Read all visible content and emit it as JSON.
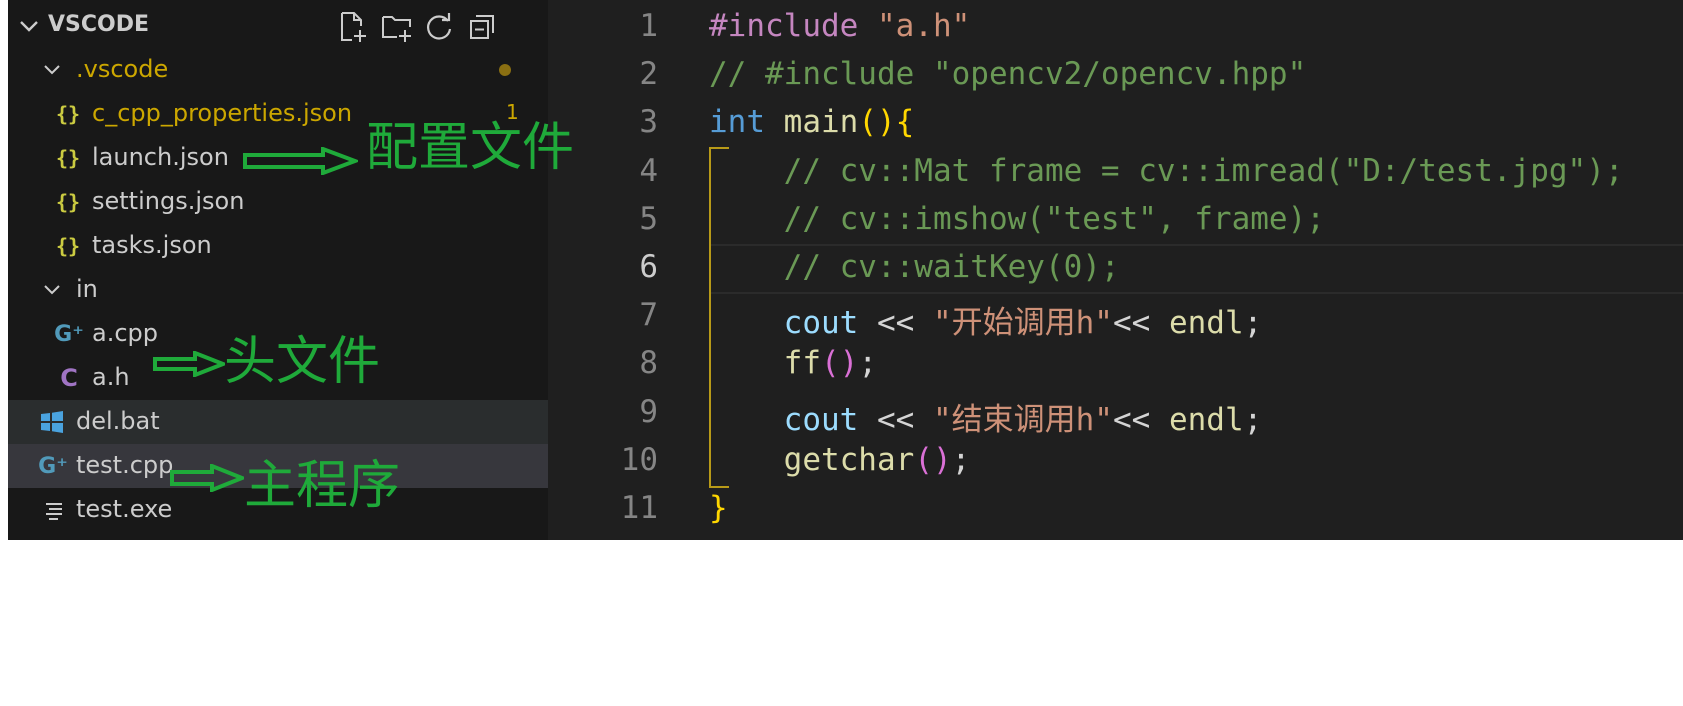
{
  "explorer": {
    "title": "VSCODE",
    "actions": [
      {
        "name": "new-file",
        "icon": "new-file-icon"
      },
      {
        "name": "new-folder",
        "icon": "new-folder-icon"
      },
      {
        "name": "refresh",
        "icon": "refresh-icon"
      },
      {
        "name": "collapse-all",
        "icon": "collapse-all-icon"
      }
    ],
    "tree": [
      {
        "label": ".vscode",
        "type": "folder",
        "expanded": true,
        "modified": true
      },
      {
        "label": "c_cpp_properties.json",
        "type": "json",
        "problems": "1",
        "modified": true
      },
      {
        "label": "launch.json",
        "type": "json"
      },
      {
        "label": "settings.json",
        "type": "json"
      },
      {
        "label": "tasks.json",
        "type": "json"
      },
      {
        "label": "in",
        "type": "folder",
        "expanded": true
      },
      {
        "label": "a.cpp",
        "type": "cpp"
      },
      {
        "label": "a.h",
        "type": "c-header"
      },
      {
        "label": "del.bat",
        "type": "windows-batch"
      },
      {
        "label": "test.cpp",
        "type": "cpp",
        "selected": true
      },
      {
        "label": "test.exe",
        "type": "binary"
      }
    ]
  },
  "annotations": {
    "config": "配置文件",
    "header": "头文件",
    "main": "主程序"
  },
  "editor": {
    "active_line": "6",
    "lines": [
      {
        "n": "1",
        "tokens": [
          {
            "t": "#include",
            "c": "macro"
          },
          {
            "t": " ",
            "c": "plain"
          },
          {
            "t": "\"a.h\"",
            "c": "str"
          }
        ]
      },
      {
        "n": "2",
        "tokens": [
          {
            "t": "// #include \"opencv2/opencv.hpp\"",
            "c": "cmt"
          }
        ]
      },
      {
        "n": "3",
        "tokens": [
          {
            "t": "int",
            "c": "kw"
          },
          {
            "t": " ",
            "c": "plain"
          },
          {
            "t": "main",
            "c": "fn"
          },
          {
            "t": "()",
            "c": "b1"
          },
          {
            "t": "{",
            "c": "b1"
          }
        ]
      },
      {
        "n": "4",
        "tokens": [
          {
            "t": "    ",
            "c": "plain"
          },
          {
            "t": "// cv::Mat frame = cv::imread(\"D:/test.jpg\");",
            "c": "cmt"
          }
        ]
      },
      {
        "n": "5",
        "tokens": [
          {
            "t": "    ",
            "c": "plain"
          },
          {
            "t": "// cv::imshow(\"test\", frame);",
            "c": "cmt"
          }
        ]
      },
      {
        "n": "6",
        "tokens": [
          {
            "t": "    ",
            "c": "plain"
          },
          {
            "t": "// cv::waitKey(0);",
            "c": "cmt"
          }
        ]
      },
      {
        "n": "7",
        "tokens": [
          {
            "t": "    ",
            "c": "plain"
          },
          {
            "t": "cout",
            "c": "var"
          },
          {
            "t": " << ",
            "c": "plain"
          },
          {
            "t": "\"开始调用h\"",
            "c": "str"
          },
          {
            "t": "<< ",
            "c": "plain"
          },
          {
            "t": "endl",
            "c": "fn"
          },
          {
            "t": ";",
            "c": "plain"
          }
        ]
      },
      {
        "n": "8",
        "tokens": [
          {
            "t": "    ",
            "c": "plain"
          },
          {
            "t": "ff",
            "c": "fn"
          },
          {
            "t": "()",
            "c": "b2"
          },
          {
            "t": ";",
            "c": "plain"
          }
        ]
      },
      {
        "n": "9",
        "tokens": [
          {
            "t": "    ",
            "c": "plain"
          },
          {
            "t": "cout",
            "c": "var"
          },
          {
            "t": " << ",
            "c": "plain"
          },
          {
            "t": "\"结束调用h\"",
            "c": "str"
          },
          {
            "t": "<< ",
            "c": "plain"
          },
          {
            "t": "endl",
            "c": "fn"
          },
          {
            "t": ";",
            "c": "plain"
          }
        ]
      },
      {
        "n": "10",
        "tokens": [
          {
            "t": "    ",
            "c": "plain"
          },
          {
            "t": "getchar",
            "c": "fn"
          },
          {
            "t": "()",
            "c": "b2"
          },
          {
            "t": ";",
            "c": "plain"
          }
        ]
      },
      {
        "n": "11",
        "tokens": [
          {
            "t": "}",
            "c": "b1"
          }
        ]
      }
    ]
  },
  "colors": {
    "sidebar_bg": "#181818",
    "editor_bg": "#1f1f1f",
    "annotation": "#1faa3a",
    "modified": "#cca700"
  }
}
